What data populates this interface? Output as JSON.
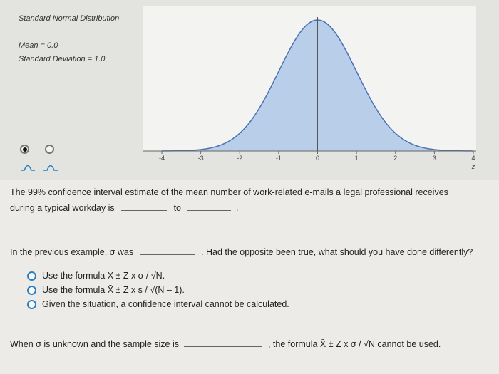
{
  "panel": {
    "title": "Standard Normal Distribution",
    "mean_label": "Mean = 0.0",
    "sd_label": "Standard Deviation = 1.0",
    "axis_label": "z",
    "ticks": [
      "-4",
      "-3",
      "-2",
      "-1",
      "0",
      "1",
      "2",
      "3",
      "4"
    ]
  },
  "chart_data": {
    "type": "area",
    "xlim": [
      -4,
      4
    ],
    "ylim": [
      0,
      0.4
    ],
    "mean": 0.0,
    "sd": 1.0,
    "fill_color": "#b9cfe9",
    "line_color": "#4a73b5",
    "x": [
      -4,
      -3.5,
      -3,
      -2.5,
      -2,
      -1.5,
      -1,
      -0.5,
      0,
      0.5,
      1,
      1.5,
      2,
      2.5,
      3,
      3.5,
      4
    ],
    "y": [
      0.0001,
      0.0009,
      0.0044,
      0.0175,
      0.054,
      0.1295,
      0.242,
      0.3521,
      0.3989,
      0.3521,
      0.242,
      0.1295,
      0.054,
      0.0175,
      0.0044,
      0.0009,
      0.0001
    ]
  },
  "q1": {
    "line1": "The 99% confidence interval estimate of the mean number of work-related e-mails a legal professional receives",
    "line2_prefix": "during a typical workday is",
    "to": "to",
    "period": "."
  },
  "q2": {
    "prefix": "In the previous example, σ was",
    "suffix": ". Had the opposite been true, what should you have done differently?",
    "options": [
      "Use the formula X̄ ± Z x σ / √N.",
      "Use the formula X̄ ± Z x s / √(N – 1).",
      "Given the situation, a confidence interval cannot be calculated."
    ]
  },
  "q3": {
    "prefix": "When σ is unknown and the sample size is",
    "suffix": ", the formula X̄ ± Z x σ / √N cannot be used."
  },
  "colors": {
    "accent": "#2a7fc0"
  }
}
